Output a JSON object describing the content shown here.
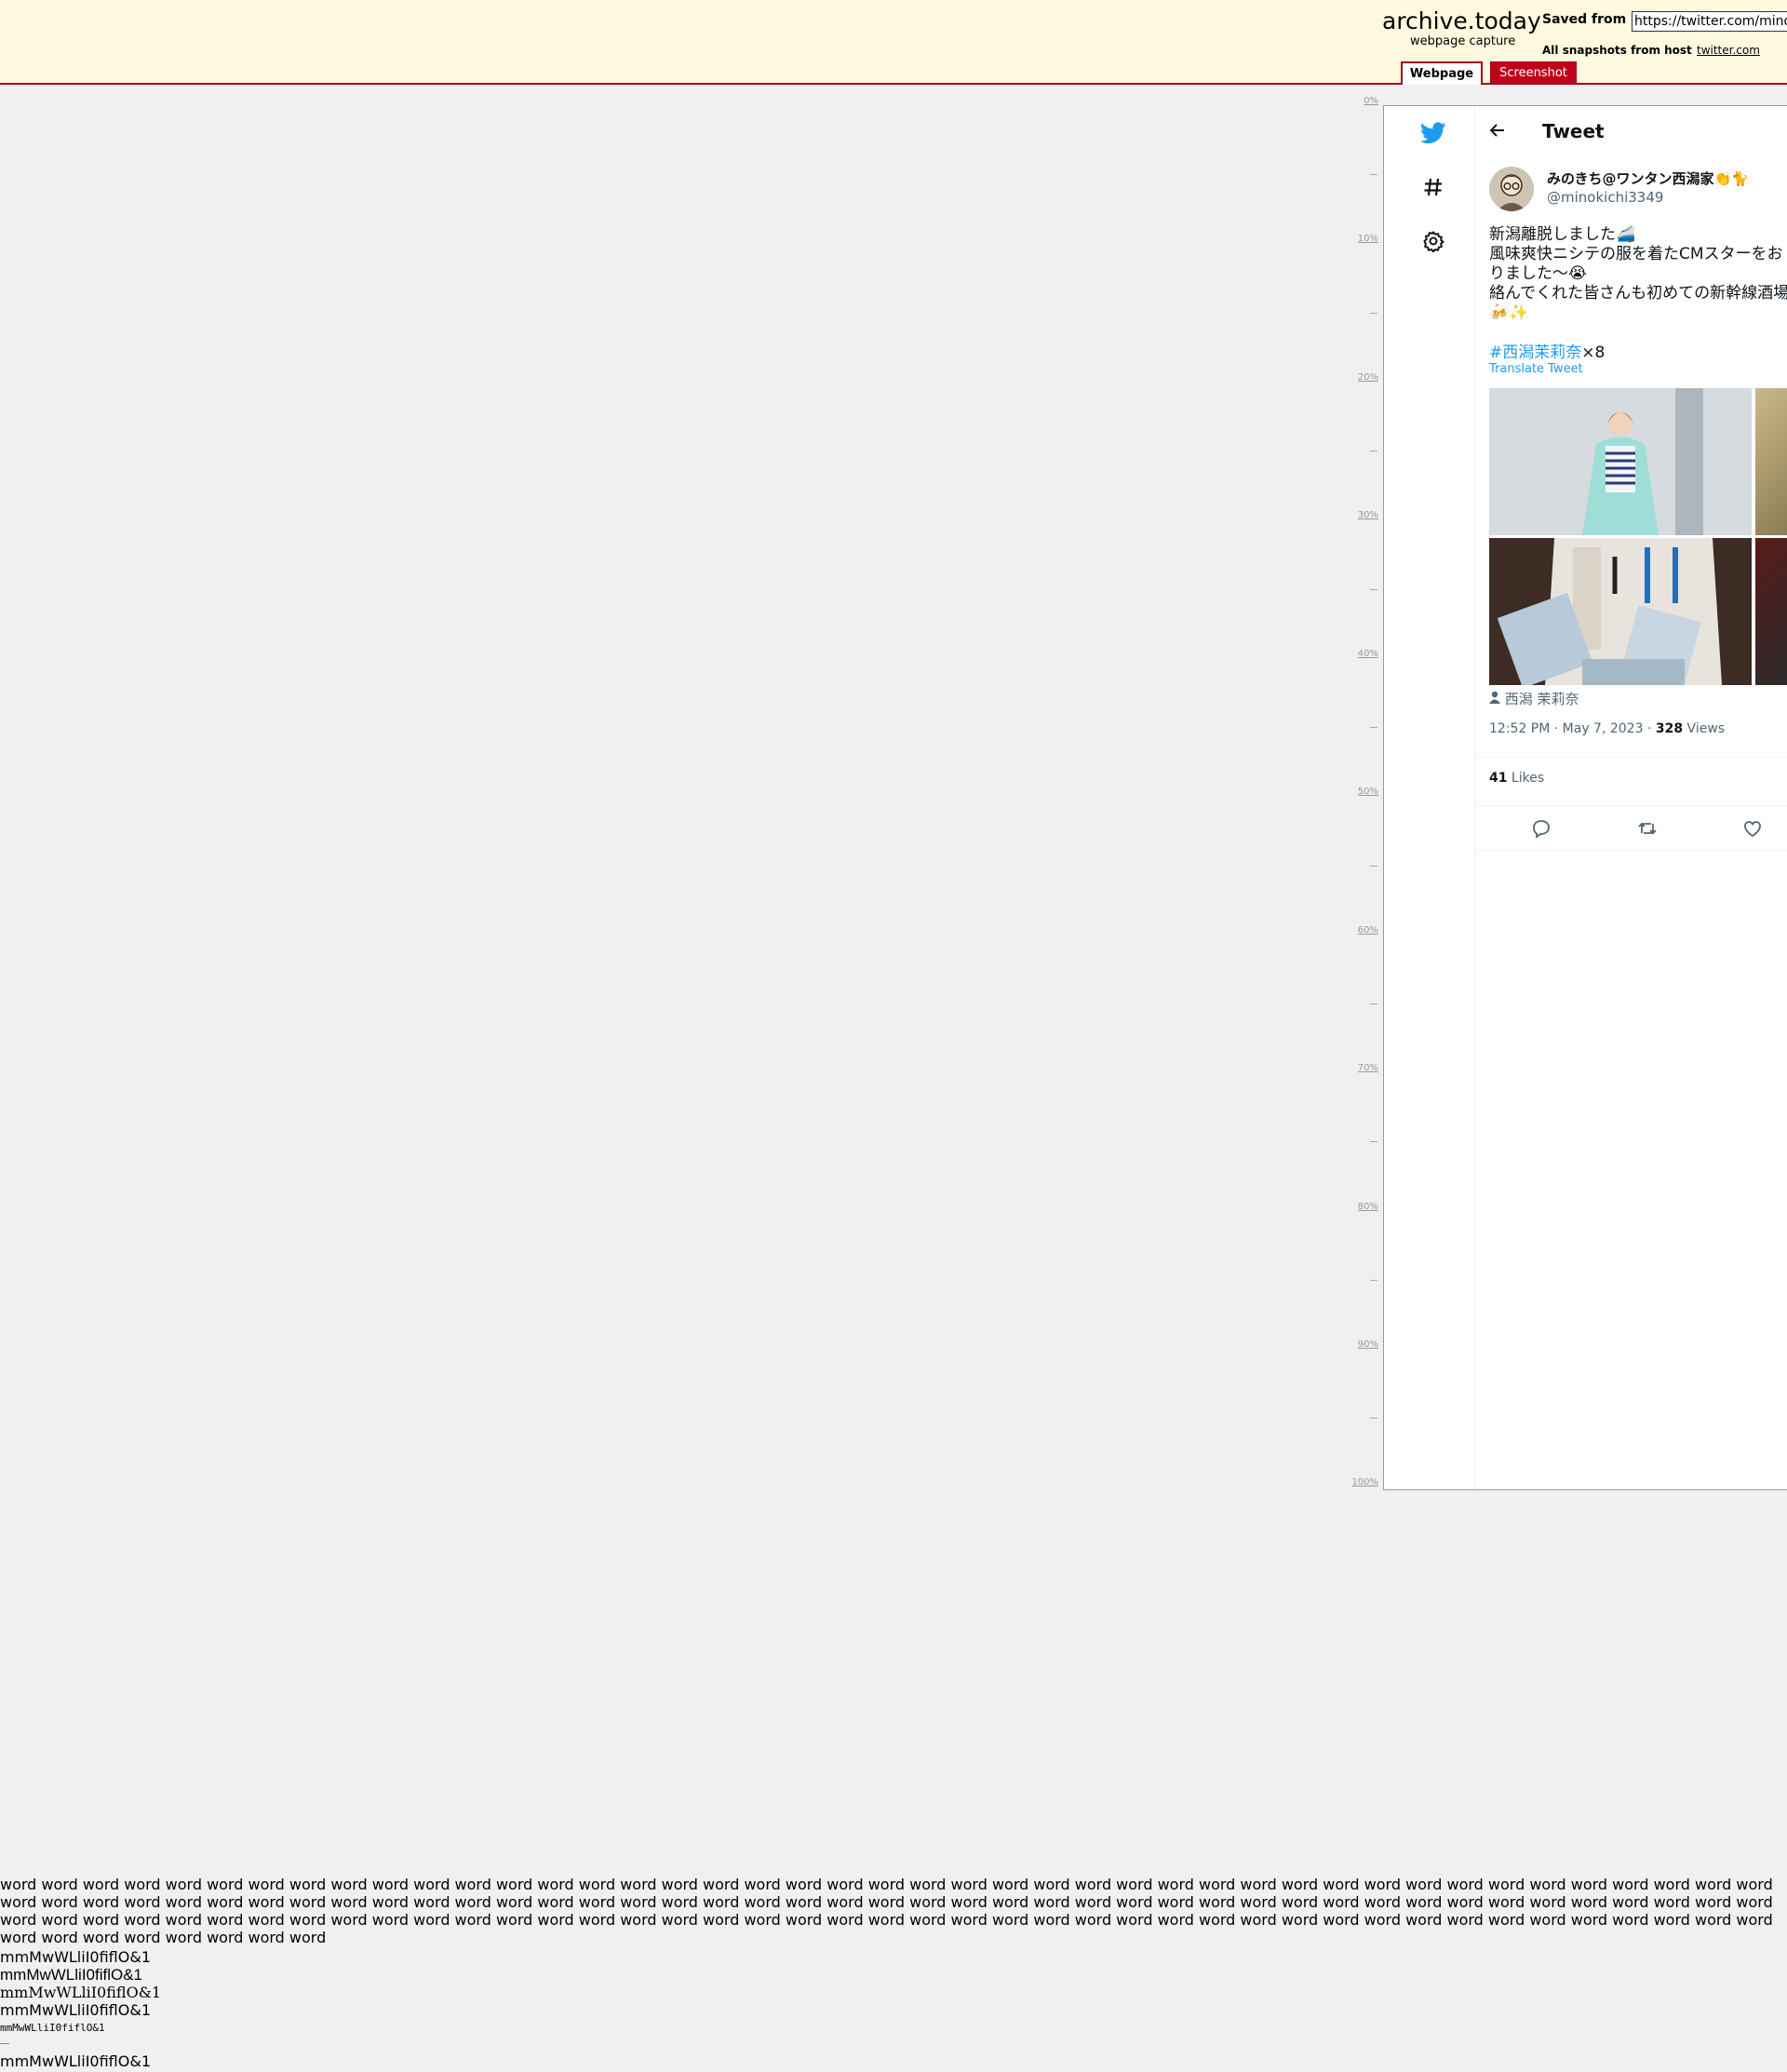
{
  "archive": {
    "brand": "archive.today",
    "tagline": "webpage capture",
    "saved_from_label": "Saved from",
    "saved_url": "https://twitter.com/minok",
    "all_snapshots_label": "All snapshots",
    "from_host_label": "from host",
    "host_link": "twitter.com",
    "tabs": [
      "Webpage",
      "Screenshot"
    ]
  },
  "ruler": [
    "0%",
    "10%",
    "20%",
    "30%",
    "40%",
    "50%",
    "60%",
    "70%",
    "80%",
    "90%",
    "100%"
  ],
  "tweet": {
    "header_title": "Tweet",
    "display_name": "みのきち@ワンタン西潟家👏🐈",
    "handle": "@minokichi3349",
    "text": "新潟離脱しました🚄\n風味爽快ニシテの服を着たCMスターをお\nりました〜😭\n絡んでくれた皆さんも初めての新幹線酒場\n🍻✨",
    "hashtag": "#西潟茉莉奈",
    "hashtag_suffix": "×8",
    "translate": "Translate Tweet",
    "photo_tag": "西潟 茉莉奈",
    "timestamp": "12:52 PM · May 7, 2023 · ",
    "views_count": "328",
    "views_label": " Views",
    "likes_count": "41",
    "likes_label": " Likes"
  },
  "test_text": {
    "word_block": "word word word word word word word word word word word word word word word word word word word word word word word word word word word word word word word word word word word word word word word word word word word word word word word word word word word word word word word word word word word word word word word word word word word word word word word word word word word word word word word word word word word word word word word word word word word word word word word word word word word word word word word word word word word word word word word word word word word word word word word word word word word word word word word word word word word word word word word word word",
    "specimens": [
      "mmMwWLliI0fiflO&1",
      "mmMwWLliI0fiflO&1",
      "mmMwWLliI0fiflO&1",
      "mmMwWLliI0fiflO&1",
      "mmMwWLliI0fiflO&1",
      "mmMwWLliI0fiflO&1"
    ]
  },
  "colors": {
    "accent": "#a00018",
    "twitter_blue": "#1d9bf0",
    "header_bg": "#fffadf"
  },
  "icons": [
    "twitter-bird-icon",
    "hashtag-icon",
    "settings-icon",
    "back-arrow-icon",
    "reply-icon",
    "retweet-icon",
    "like-icon",
    "person-icon"
  ]
}
